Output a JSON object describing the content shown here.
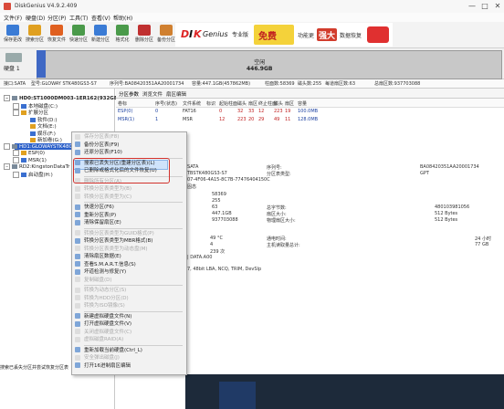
{
  "window": {
    "title": "DiskGenius V4.9.2.409",
    "controls": [
      "—",
      "□",
      "✕"
    ]
  },
  "menu": [
    "文件(F)",
    "硬盘(D)",
    "分区(P)",
    "工具(T)",
    "查看(V)",
    "帮助(H)"
  ],
  "toolbar": {
    "buttons": [
      "保存更改",
      "搜索分区",
      "恢复文件",
      "快速分区",
      "新建分区",
      "格式化",
      "删除分区",
      "备份分区"
    ],
    "colors": [
      "#3a7bd5",
      "#e0a020",
      "#e06020",
      "#4a9a4a",
      "#3a7bd5",
      "#4a9a4a",
      "#c03030",
      "#d08030"
    ],
    "banner_logo": "DISKGenius",
    "banner_text": [
      "免费下载",
      "功能更强大",
      "数据恢复"
    ]
  },
  "diskmap": {
    "disk_label": "硬盘 1",
    "free_title": "空闲",
    "free_size": "446.9GB"
  },
  "infoline": [
    "接口:SATA",
    "型号:GLOWAY STK480GS3-S7",
    "序列号:BA08420351AA20001734",
    "容量:447.1GB(457862MB)",
    "柱面数:58369",
    "磁头数:255",
    "每道扇区数:63",
    "总扇区数:937703088"
  ],
  "tree": {
    "nodes": [
      {
        "label": "HD0:ST1000DM003-1ER162(932GB)",
        "level": 0,
        "bold": true
      },
      {
        "label": "本地磁盘(C:)",
        "level": 1
      },
      {
        "label": "扩展分区",
        "level": 1
      },
      {
        "label": "软件(D:)",
        "level": 2
      },
      {
        "label": "文档(E:)",
        "level": 2
      },
      {
        "label": "娱乐(F:)",
        "level": 2
      },
      {
        "label": "新加卷(G:)",
        "level": 2
      },
      {
        "label": "HD1:GLOWAYSTK480GS3",
        "level": 0,
        "selected": true
      },
      {
        "label": "ESP(0)",
        "level": 1
      },
      {
        "label": "MSR(1)",
        "level": 1
      },
      {
        "label": "RD2:KingstonDataTr",
        "level": 0
      },
      {
        "label": "启动盘(H:)",
        "level": 1
      }
    ]
  },
  "tabs": [
    "分区参数",
    "浏览文件",
    "扇区编辑"
  ],
  "table": {
    "headers": [
      "卷标",
      "序号(状态)",
      "文件系统",
      "标识",
      "起始柱面",
      "磁头",
      "扇区",
      "终止柱面",
      "磁头",
      "扇区",
      "容量"
    ],
    "rows": [
      [
        "ESP(0)",
        "0",
        "FAT16",
        "",
        "0",
        "32",
        "33",
        "12",
        "223",
        "19",
        "100.0MB"
      ],
      [
        "MSR(1)",
        "1",
        "MSR",
        "",
        "12",
        "223",
        "20",
        "29",
        "49",
        "11",
        "128.0MB"
      ]
    ]
  },
  "details": {
    "left": [
      "SATA",
      "TBSTK480GS3-S7",
      "07-4F06-4A15-8C7B-77476404150C",
      "固态"
    ],
    "right_labels": [
      "序列号:",
      "分区表类型:"
    ],
    "right_values": [
      "BA08420351AA20001734",
      "GPT"
    ],
    "mid_labels": [
      "58369",
      "255",
      "63",
      "447.1GB",
      "937703088"
    ],
    "mid2_labels": [
      "总字节数:",
      "扇区大小:",
      "物理扇区大小:"
    ],
    "mid2_values": [
      "480103981056",
      "512 Bytes",
      "512 Bytes"
    ],
    "temp": [
      "49 °C",
      "4",
      "239 次"
    ],
    "temp_labels": [
      "通电时间:",
      "主机读取量总计:"
    ],
    "temp_values": [
      "24 小时",
      "77 GB"
    ],
    "extra": [
      "| DATA.A00",
      "7, 48bit LBA, NCQ, TRIM, DevSlp"
    ]
  },
  "context_menu": [
    {
      "label": "保存分区表(F8)",
      "disabled": true
    },
    {
      "label": "备份分区表(F9)"
    },
    {
      "label": "还原分区表(F10)"
    },
    {
      "sep": true
    },
    {
      "label": "搜索已丢失分区(重建分区表)(L)",
      "highlight": true
    },
    {
      "label": "已删除或格式化后的文件恢复(U)"
    },
    {
      "sep": true
    },
    {
      "label": "删除所有分区(A)",
      "disabled": true
    },
    {
      "label": "转换分区表类型为(B)",
      "disabled": true
    },
    {
      "label": "转换分区表类型为(C)",
      "disabled": true
    },
    {
      "sep": true
    },
    {
      "label": "快速分区(F6)"
    },
    {
      "label": "重新分区表(P)"
    },
    {
      "label": "清除保留扇区(E)"
    },
    {
      "sep": true
    },
    {
      "label": "转换分区表类型为GUID格式(P)",
      "disabled": true
    },
    {
      "label": "转换分区表类型为MBR格式(B)"
    },
    {
      "label": "转换分区表类型为动态盘(M)",
      "disabled": true
    },
    {
      "label": "清除扇区数据(E)"
    },
    {
      "label": "查看S.M.A.R.T.信息(S)"
    },
    {
      "label": "坏道检测与修复(Y)"
    },
    {
      "label": "复制磁盘(D)",
      "disabled": true
    },
    {
      "sep": true
    },
    {
      "label": "转换为动态分区(S)",
      "disabled": true
    },
    {
      "label": "转换为HDD分区(D)",
      "disabled": true
    },
    {
      "label": "转换为ISO镜像(S)",
      "disabled": true
    },
    {
      "sep": true
    },
    {
      "label": "新建虚拟硬盘文件(N)"
    },
    {
      "label": "打开虚拟硬盘文件(V)"
    },
    {
      "label": "关闭虚拟硬盘文件(C)",
      "disabled": true
    },
    {
      "label": "虚拟磁盘RAID(A)",
      "disabled": true
    },
    {
      "sep": true
    },
    {
      "label": "重新加载当前硬盘(Ctrl_L)"
    },
    {
      "label": "安全弹出磁盘(J)",
      "disabled": true
    },
    {
      "label": "打开16进制扇区编辑"
    }
  ],
  "statusbar": "搜索已丢失分区并尝试恢复分区表"
}
